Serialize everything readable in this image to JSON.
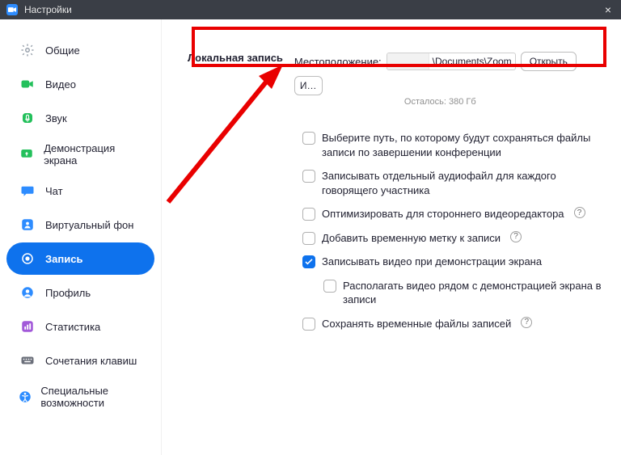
{
  "window": {
    "title": "Настройки",
    "close_glyph": "×"
  },
  "sidebar": {
    "items": [
      {
        "label": "Общие",
        "icon": "settings-icon",
        "color": "#9aa3ad"
      },
      {
        "label": "Видео",
        "icon": "video-icon",
        "color": "#23c05b"
      },
      {
        "label": "Звук",
        "icon": "audio-icon",
        "color": "#23c05b"
      },
      {
        "label": "Демонстрация экрана",
        "icon": "share-screen-icon",
        "color": "#23c05b"
      },
      {
        "label": "Чат",
        "icon": "chat-icon",
        "color": "#2d8cff"
      },
      {
        "label": "Виртуальный фон",
        "icon": "virtual-bg-icon",
        "color": "#2d8cff"
      },
      {
        "label": "Запись",
        "icon": "record-icon",
        "color": "#ffffff",
        "active": true
      },
      {
        "label": "Профиль",
        "icon": "profile-icon",
        "color": "#2d8cff"
      },
      {
        "label": "Статистика",
        "icon": "stats-icon",
        "color": "#a259d9"
      },
      {
        "label": "Сочетания клавиш",
        "icon": "keyboard-icon",
        "color": "#6b6f7a"
      },
      {
        "label": "Специальные возможности",
        "icon": "accessibility-icon",
        "color": "#2d8cff"
      }
    ]
  },
  "recording": {
    "section_title": "Локальная запись",
    "location_label": "Местоположение:",
    "path_visible": "\\Documents\\Zoom",
    "open_btn": "Открыть",
    "change_btn": "И…",
    "remaining": "Осталось: 380 Гб",
    "options": [
      {
        "label": "Выберите путь, по которому будут сохраняться файлы записи по завершении конференции",
        "checked": false
      },
      {
        "label": "Записывать отдельный аудиофайл для каждого говорящего участника",
        "checked": false
      },
      {
        "label": "Оптимизировать для стороннего видеоредактора",
        "checked": false,
        "help": true
      },
      {
        "label": "Добавить временную метку к записи",
        "checked": false,
        "help": true
      },
      {
        "label": "Записывать видео при демонстрации экрана",
        "checked": true
      },
      {
        "label": "Располагать видео рядом с демонстрацией экрана в записи",
        "checked": false,
        "indent": true
      },
      {
        "label": "Сохранять временные файлы записей",
        "checked": false,
        "help": true
      }
    ]
  },
  "help_glyph": "?"
}
